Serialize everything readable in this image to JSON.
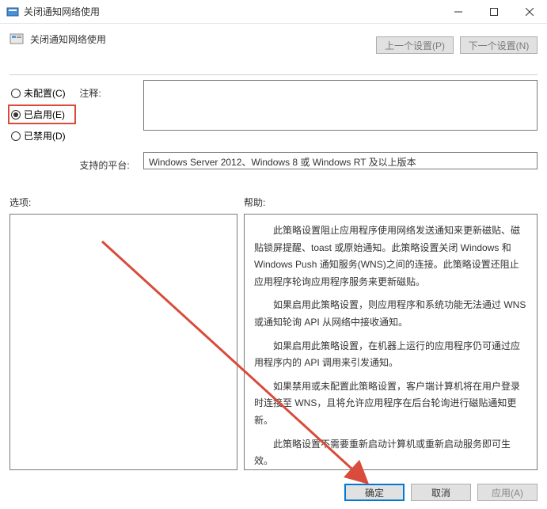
{
  "titlebar": {
    "title": "关闭通知网络使用"
  },
  "subheader": {
    "title": "关闭通知网络使用"
  },
  "nav": {
    "prev": "上一个设置(P)",
    "next": "下一个设置(N)"
  },
  "radios": {
    "not_configured": "未配置(C)",
    "enabled": "已启用(E)",
    "disabled": "已禁用(D)"
  },
  "labels": {
    "annotation": "注释:",
    "platform": "支持的平台:",
    "options": "选项:",
    "help": "帮助:"
  },
  "platform_text": "Windows Server 2012、Windows 8 或 Windows RT 及以上版本",
  "help": {
    "p1": "此策略设置阻止应用程序使用网络发送通知来更新磁贴、磁贴锁屏提醒、toast 或原始通知。此策略设置关闭 Windows 和 Windows Push 通知服务(WNS)之间的连接。此策略设置还阻止应用程序轮询应用程序服务来更新磁贴。",
    "p2": "如果启用此策略设置，则应用程序和系统功能无法通过 WNS 或通知轮询 API 从网络中接收通知。",
    "p3": "如果启用此策略设置，在机器上运行的应用程序仍可通过应用程序内的 API 调用来引发通知。",
    "p4": "如果禁用或未配置此策略设置，客户端计算机将在用户登录时连接至 WNS，且将允许应用程序在后台轮询进行磁贴通知更新。",
    "p5": "此策略设置不需要重新启动计算机或重新启动服务即可生效。"
  },
  "footer": {
    "ok": "确定",
    "cancel": "取消",
    "apply": "应用(A)"
  }
}
